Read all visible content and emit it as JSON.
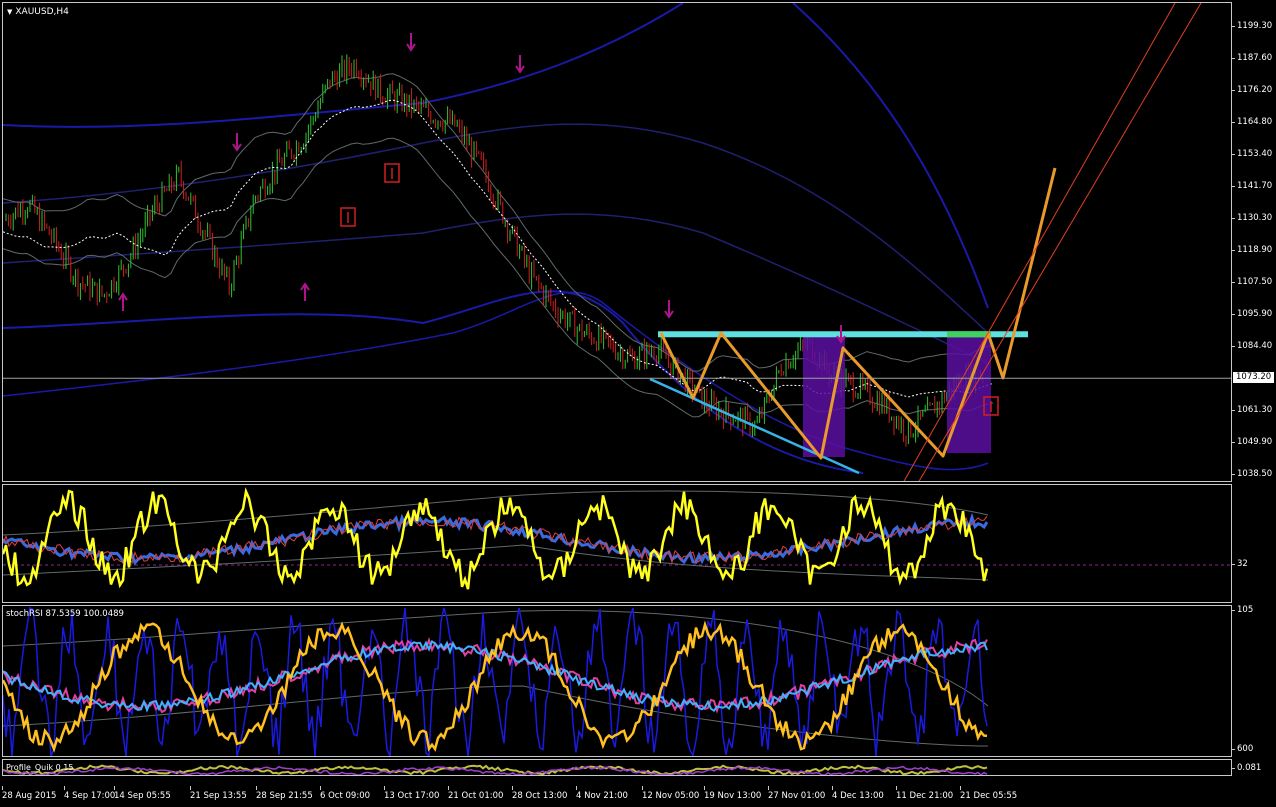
{
  "window": {
    "symbol_label": "XAUUSD,H4"
  },
  "colors": {
    "background": "#000000",
    "bull_candle": "#2ec62e",
    "bear_candle": "#d02020",
    "envelope": "#1a1aa8",
    "bollinger": "#5f6a6a",
    "zigzag": "#e89a2b",
    "resistance": "#5fe0e0",
    "trendline": "#34b4e8",
    "box": "#5a0fa0",
    "arrow_marker": "#b0148c",
    "rsi_yellow": "#ffff20",
    "stoch_blue": "#1a1ae0"
  },
  "price_scale": {
    "ticks": [
      "1199.30",
      "1187.60",
      "1176.20",
      "1164.80",
      "1153.40",
      "1141.70",
      "1130.30",
      "1118.90",
      "1107.50",
      "1095.90",
      "1084.40",
      "1061.30",
      "1049.90",
      "1038.50"
    ],
    "current_price": "1073.20"
  },
  "indicator1": {
    "scale_label": "32"
  },
  "indicator2": {
    "label": "stochRSI 87.5359 100.0489",
    "scale_top": "105",
    "scale_bottom": "600"
  },
  "indicator3": {
    "label": "Profile_Quik 0.15",
    "scale_label": "0.081"
  },
  "time_axis": {
    "labels": [
      "28 Aug 2015",
      "4 Sep 17:00",
      "14 Sep 05:55",
      "21 Sep 13:55",
      "28 Sep 21:55",
      "6 Oct 09:00",
      "13 Oct 17:00",
      "21 Oct 01:00",
      "28 Oct 13:00",
      "4 Nov 21:00",
      "12 Nov 05:00",
      "19 Nov 13:00",
      "27 Nov 01:00",
      "4 Dec 13:00",
      "11 Dec 21:00",
      "21 Dec 05:55"
    ]
  },
  "chart_data": {
    "type": "candlestick",
    "symbol": "XAUUSD",
    "timeframe": "H4",
    "x": [
      "28 Aug 2015",
      "4 Sep 17:00",
      "14 Sep 05:55",
      "21 Sep 13:55",
      "28 Sep 21:55",
      "6 Oct 09:00",
      "13 Oct 17:00",
      "21 Oct 01:00",
      "28 Oct 13:00",
      "4 Nov 21:00",
      "12 Nov 05:00",
      "19 Nov 13:00",
      "27 Nov 01:00",
      "4 Dec 13:00",
      "11 Dec 21:00",
      "21 Dec 05:55"
    ],
    "close_path": [
      1130,
      1136,
      1123,
      1108,
      1103,
      1116,
      1134,
      1146,
      1126,
      1106,
      1138,
      1150,
      1160,
      1180,
      1186,
      1176,
      1172,
      1168,
      1164,
      1150,
      1130,
      1110,
      1098,
      1090,
      1086,
      1080,
      1084,
      1074,
      1064,
      1060,
      1056,
      1078,
      1086,
      1074,
      1070,
      1064,
      1054,
      1062,
      1072,
      1076
    ],
    "resistance_level": 1089,
    "current_price": 1073.2,
    "ylim": [
      1038.5,
      1205
    ],
    "grid": false
  }
}
